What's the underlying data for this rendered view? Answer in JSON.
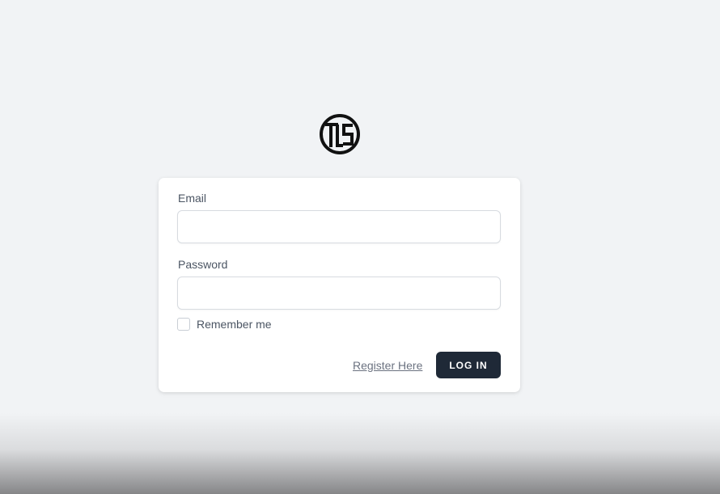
{
  "logo": {
    "icon": "tls-logo",
    "text": "TLS"
  },
  "form": {
    "email_label": "Email",
    "email_value": "",
    "email_placeholder": "",
    "password_label": "Password",
    "password_value": "",
    "password_placeholder": "",
    "remember_label": "Remember me",
    "remember_checked": false,
    "register_link": "Register Here",
    "login_button": "LOG IN"
  },
  "colors": {
    "background": "#f1f3f5",
    "card": "#ffffff",
    "button": "#1f2937",
    "button_text": "#ffffff"
  }
}
